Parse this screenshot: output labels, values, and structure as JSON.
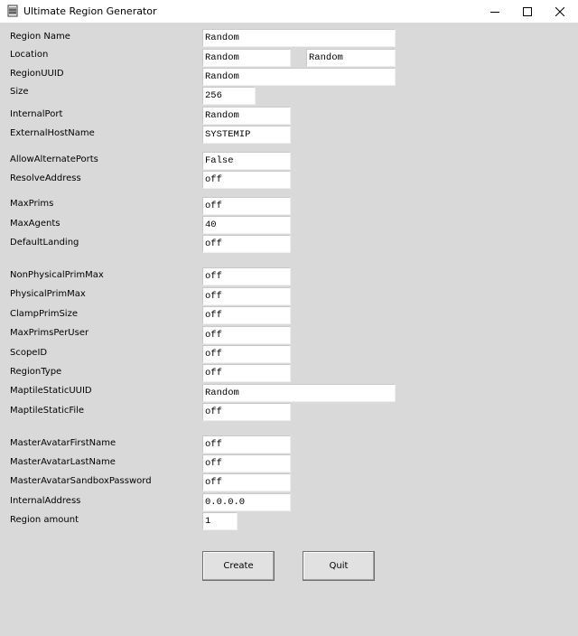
{
  "window": {
    "title": "Ultimate Region Generator",
    "icon": "app-icon",
    "controls": [
      "minimize-icon",
      "maximize-icon",
      "close-icon"
    ]
  },
  "form": {
    "region_name": {
      "label": "Region Name",
      "value": "Random"
    },
    "location": {
      "label": "Location",
      "value_x": "Random",
      "value_y": "Random"
    },
    "region_uuid": {
      "label": "RegionUUID",
      "value": "Random"
    },
    "size": {
      "label": "Size",
      "value": "256"
    },
    "internal_port": {
      "label": "InternalPort",
      "value": "Random"
    },
    "external_host_name": {
      "label": "ExternalHostName",
      "value": "SYSTEMIP"
    },
    "allow_alternate_ports": {
      "label": "AllowAlternatePorts",
      "value": "False"
    },
    "resolve_address": {
      "label": "ResolveAddress",
      "value": "off"
    },
    "max_prims": {
      "label": "MaxPrims",
      "value": "off"
    },
    "max_agents": {
      "label": "MaxAgents",
      "value": "40"
    },
    "default_landing": {
      "label": "DefaultLanding",
      "value": "off"
    },
    "non_physical_prim_max": {
      "label": "NonPhysicalPrimMax",
      "value": "off"
    },
    "physical_prim_max": {
      "label": "PhysicalPrimMax",
      "value": "off"
    },
    "clamp_prim_size": {
      "label": "ClampPrimSize",
      "value": "off"
    },
    "max_prims_per_user": {
      "label": "MaxPrimsPerUser",
      "value": "off"
    },
    "scope_id": {
      "label": "ScopeID",
      "value": "off"
    },
    "region_type": {
      "label": "RegionType",
      "value": "off"
    },
    "maptile_static_uuid": {
      "label": "MaptileStaticUUID",
      "value": "Random"
    },
    "maptile_static_file": {
      "label": "MaptileStaticFile",
      "value": "off"
    },
    "master_avatar_first_name": {
      "label": "MasterAvatarFirstName",
      "value": "off"
    },
    "master_avatar_last_name": {
      "label": "MasterAvatarLastName",
      "value": "off"
    },
    "master_avatar_sandbox_password": {
      "label": "MasterAvatarSandboxPassword",
      "value": "off"
    },
    "internal_address": {
      "label": "InternalAddress",
      "value": "0.0.0.0"
    },
    "region_amount": {
      "label": "Region amount",
      "value": "1"
    }
  },
  "buttons": {
    "create": "Create",
    "quit": "Quit"
  }
}
